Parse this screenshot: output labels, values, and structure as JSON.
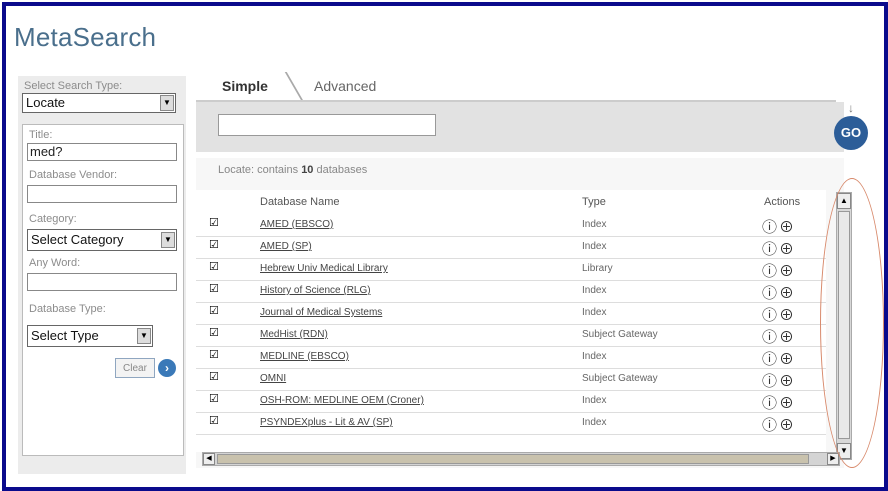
{
  "app": {
    "title": "MetaSearch"
  },
  "left_panel": {
    "search_type_label": "Select Search Type:",
    "search_type_value": "Locate",
    "title_label": "Title:",
    "title_value": "med?",
    "vendor_label": "Database Vendor:",
    "vendor_value": "",
    "category_label": "Category:",
    "category_value": "Select Category",
    "anyword_label": "Any Word:",
    "anyword_value": "",
    "dbtype_label": "Database Type:",
    "dbtype_value": "Select Type",
    "clear_label": "Clear"
  },
  "tabs": [
    {
      "label": "Simple"
    },
    {
      "label": "Advanced"
    }
  ],
  "search": {
    "go_label": "GO",
    "query": ""
  },
  "results": {
    "summary_prefix": "Locate: contains",
    "summary_count": "10",
    "summary_suffix": "databases",
    "headers": {
      "name": "Database Name",
      "type": "Type",
      "actions": "Actions"
    },
    "rows": [
      {
        "name": "AMED (EBSCO)",
        "type": "Index"
      },
      {
        "name": "AMED (SP)",
        "type": "Index"
      },
      {
        "name": "Hebrew Univ Medical Library",
        "type": "Library"
      },
      {
        "name": "History of Science (RLG)",
        "type": "Index"
      },
      {
        "name": "Journal of Medical Systems",
        "type": "Index"
      },
      {
        "name": "MedHist (RDN)",
        "type": "Subject Gateway"
      },
      {
        "name": "MEDLINE (EBSCO)",
        "type": "Index"
      },
      {
        "name": "OMNI",
        "type": "Subject Gateway"
      },
      {
        "name": "OSH-ROM: MEDLINE OEM (Croner)",
        "type": "Index"
      },
      {
        "name": "PSYNDEXplus - Lit & AV (SP)",
        "type": "Index"
      }
    ]
  },
  "icons": {
    "info": "info-icon",
    "add": "add-icon"
  },
  "colors": {
    "frame": "#0a0a8c",
    "title": "#4a6f8c",
    "go_button": "#2c5d98",
    "annotation_oval": "#d88a6c"
  }
}
